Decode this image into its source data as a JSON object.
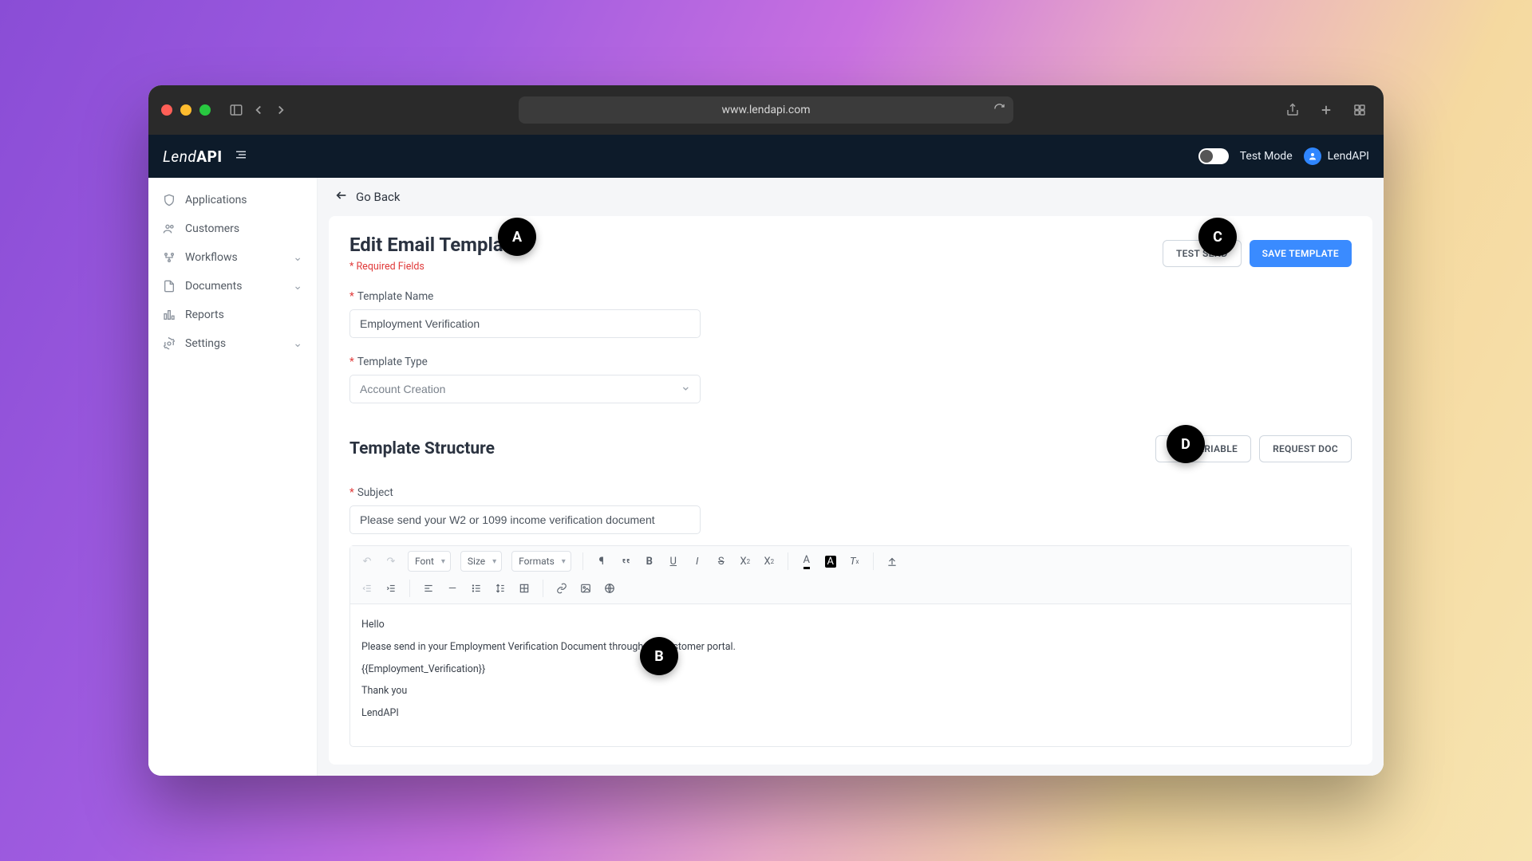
{
  "browser": {
    "url": "www.lendapi.com"
  },
  "brand": {
    "lend": "Lend",
    "api": "API"
  },
  "header": {
    "test_mode_label": "Test Mode",
    "user_name": "LendAPI"
  },
  "sidebar": {
    "items": [
      {
        "label": "Applications",
        "expandable": false
      },
      {
        "label": "Customers",
        "expandable": false
      },
      {
        "label": "Workflows",
        "expandable": true
      },
      {
        "label": "Documents",
        "expandable": true
      },
      {
        "label": "Reports",
        "expandable": false
      },
      {
        "label": "Settings",
        "expandable": true
      }
    ]
  },
  "go_back": "Go Back",
  "page": {
    "title": "Edit Email Template",
    "required_note": "* Required Fields",
    "actions": {
      "test_send": "TEST SEND",
      "save": "SAVE TEMPLATE"
    },
    "fields": {
      "template_name_label": "Template Name",
      "template_name_value": "Employment Verification",
      "template_type_label": "Template Type",
      "template_type_value": "Account Creation"
    },
    "structure_title": "Template Structure",
    "structure_actions": {
      "add_variable": "ADD VARIABLE",
      "request_doc": "REQUEST DOC"
    },
    "subject_label": "Subject",
    "subject_value": "Please send your W2 or 1099 income verification document",
    "toolbar": {
      "font_label": "Font",
      "size_label": "Size",
      "formats_label": "Formats"
    },
    "body_lines": [
      "Hello",
      "Please send in your Employment Verification Document through the customer portal.",
      "{{Employment_Verification}}",
      "Thank you",
      "LendAPI"
    ]
  },
  "annotations": {
    "A": "A",
    "B": "B",
    "C": "C",
    "D": "D"
  }
}
